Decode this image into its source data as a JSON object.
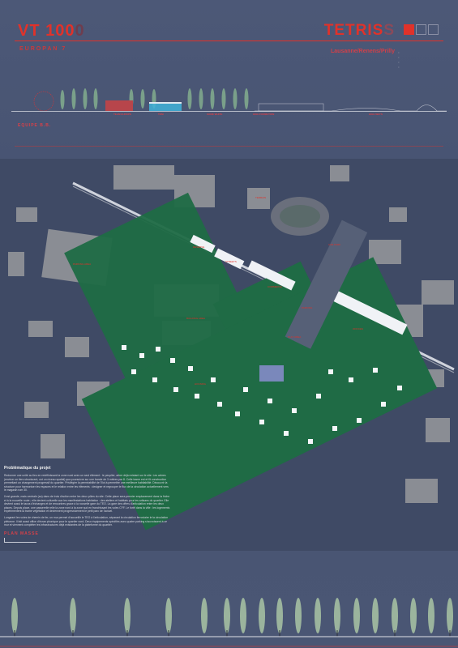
{
  "header": {
    "project_code": "VT 100",
    "project_code_suffix": "0",
    "competition": "EUROPAN 7",
    "brand": "TETRIS",
    "brand_suffix": "S",
    "location": "Lausanne/Renens/Prilly"
  },
  "section_labels": [
    "TEAM EUROPE",
    "TOM",
    "SOME WHITE",
    "HIGH FORMATION",
    "HIGH WAYS"
  ],
  "team_label": "EQUIPE B.B.",
  "map_labels": [
    "PARKING AREA",
    "TERRAIN",
    "RESERVE",
    "STREETS",
    "BUILDING AREA",
    "CAR PARK",
    "PLAY AREA",
    "COMMERCE",
    "HOUSING",
    "PARKING",
    "OFFICES"
  ],
  "text_block": {
    "title": "Problématique du projet",
    "para1": "Redonner une unité au lieu en redéfinissant la zone rural avec un seul élément : le peuplier, arbre déjà existant sur le site. Les arbres (environ un tiers structurant, ont un niveau spatial) qua poursuivre sur une bande de 3 mètres par 8. Celle trame est et fit construction permettant un changement progressif du quartier. Privilégier la perméabilité de l'îlot à permettre une meilleure habitabilité. Découvrir la structure pour harmoniser les espaces et le relation entre les éléments : designer et regrouper le flux de la circulation actuellement vers le magasin rum 30.",
    "para2": "Il est grande, mais centrale (au) dans de trois d'action entre les deux pôles du site. Cette place sera premier emplacement dans la friche et à la nouvelle route ; elle devient culturelle aux les manifestations habitation : des ateliers et habitats pour les artisans du quartier. Elle devient aussi le tacos d'échanges et de rencontres grace à la nouvelle gare du TEO. La gare des offres d'articulation entre les deux places. Depuis place, une passerelle relie la zone nord à la zone sud en franchissant les voies CFF. Le forêt dans la ville : les logements expérimentent la trame végétation et deviennent progressivement le petit parc de l'actuel.",
    "para3": "Longeant les voies de chemin de fer, un mur permet d'accueillir le TEO à l'articulation, séparant la circulation ferroviaire le la circulation piétonne. Il fait aussi office d'écran phonique pour le quartier nord. Deux équipements spécifiés avec quatre parking s'accroissent à ce mur et viennent compléter les infrastructures déjà existantes de la plateforme du quartier."
  },
  "plan_label": "PLAN MASSE",
  "colors": {
    "accent": "#e0322a",
    "background": "#4a5674",
    "tree": "#1f6b45",
    "building": "#8a8d94"
  }
}
